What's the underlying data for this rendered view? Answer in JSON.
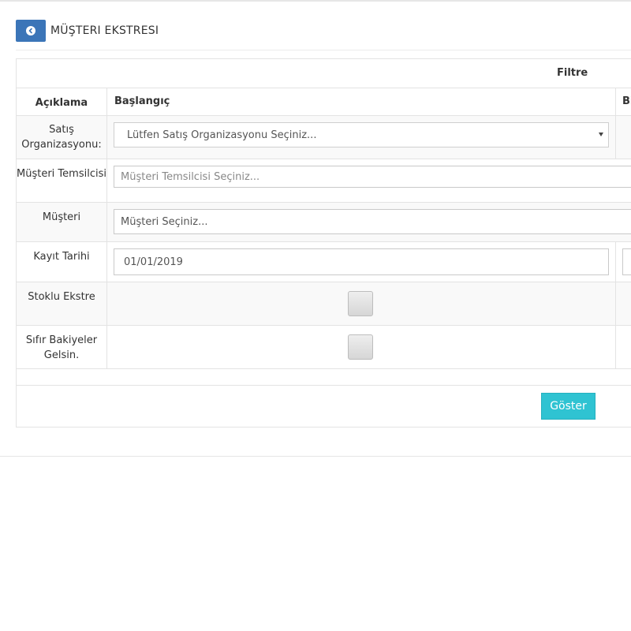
{
  "header": {
    "title": "MÜŞTERI EKSTRESI",
    "back_icon": "chevron-left-circle-icon",
    "accent_color": "#3b75b8"
  },
  "filter": {
    "title": "Filtre",
    "columns": {
      "description": "Açıklama",
      "start": "Başlangıç",
      "end_partial": "Bi"
    }
  },
  "rows": {
    "sales_org": {
      "label": "Satış Organizasyonu:",
      "selected": "Lütfen Satış Organizasyonu Seçiniz..."
    },
    "customer_rep": {
      "label": "Müşteri Temsilcisi",
      "placeholder": "Müşteri Temsilcisi Seçiniz..."
    },
    "customer": {
      "label": "Müşteri",
      "placeholder": "Müşteri Seçiniz..."
    },
    "record_date": {
      "label": "Kayıt Tarihi",
      "start_value": "01/01/2019"
    },
    "stock_statement": {
      "label": "Stoklu Ekstre",
      "checked": false
    },
    "zero_balances": {
      "label": "Sıfır Bakiyeler Gelsin.",
      "checked": false
    }
  },
  "actions": {
    "show_label": "Göster",
    "show_color": "#2fc3d2"
  }
}
